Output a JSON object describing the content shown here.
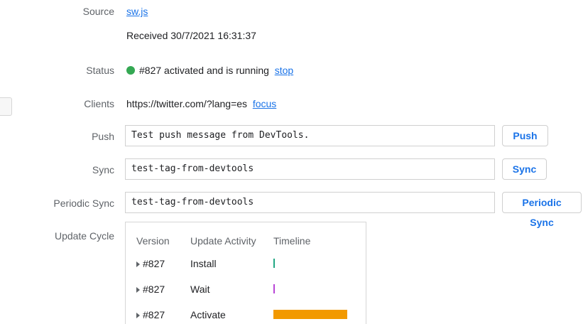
{
  "source": {
    "label": "Source",
    "file_link": "sw.js",
    "received": "Received 30/7/2021 16:31:37"
  },
  "status": {
    "label": "Status",
    "text": "#827 activated and is running",
    "action_link": "stop",
    "dot_color": "#34a853"
  },
  "clients": {
    "label": "Clients",
    "url": "https://twitter.com/?lang=es",
    "action_link": "focus"
  },
  "push": {
    "label": "Push",
    "input_value": "Test push message from DevTools.",
    "button_label": "Push"
  },
  "sync": {
    "label": "Sync",
    "input_value": "test-tag-from-devtools",
    "button_label": "Sync"
  },
  "periodic_sync": {
    "label": "Periodic Sync",
    "input_value": "test-tag-from-devtools",
    "button_label": "Periodic Sync"
  },
  "update_cycle": {
    "label": "Update Cycle",
    "headers": {
      "version": "Version",
      "activity": "Update Activity",
      "timeline": "Timeline"
    },
    "rows": [
      {
        "version": "#827",
        "activity": "Install",
        "bar_color": "#21a783"
      },
      {
        "version": "#827",
        "activity": "Wait",
        "bar_color": "#b845d6"
      },
      {
        "version": "#827",
        "activity": "Activate",
        "bar_color": "#f29900"
      }
    ]
  },
  "colors": {
    "link": "#1a73e8",
    "label_gray": "#5f6368"
  }
}
